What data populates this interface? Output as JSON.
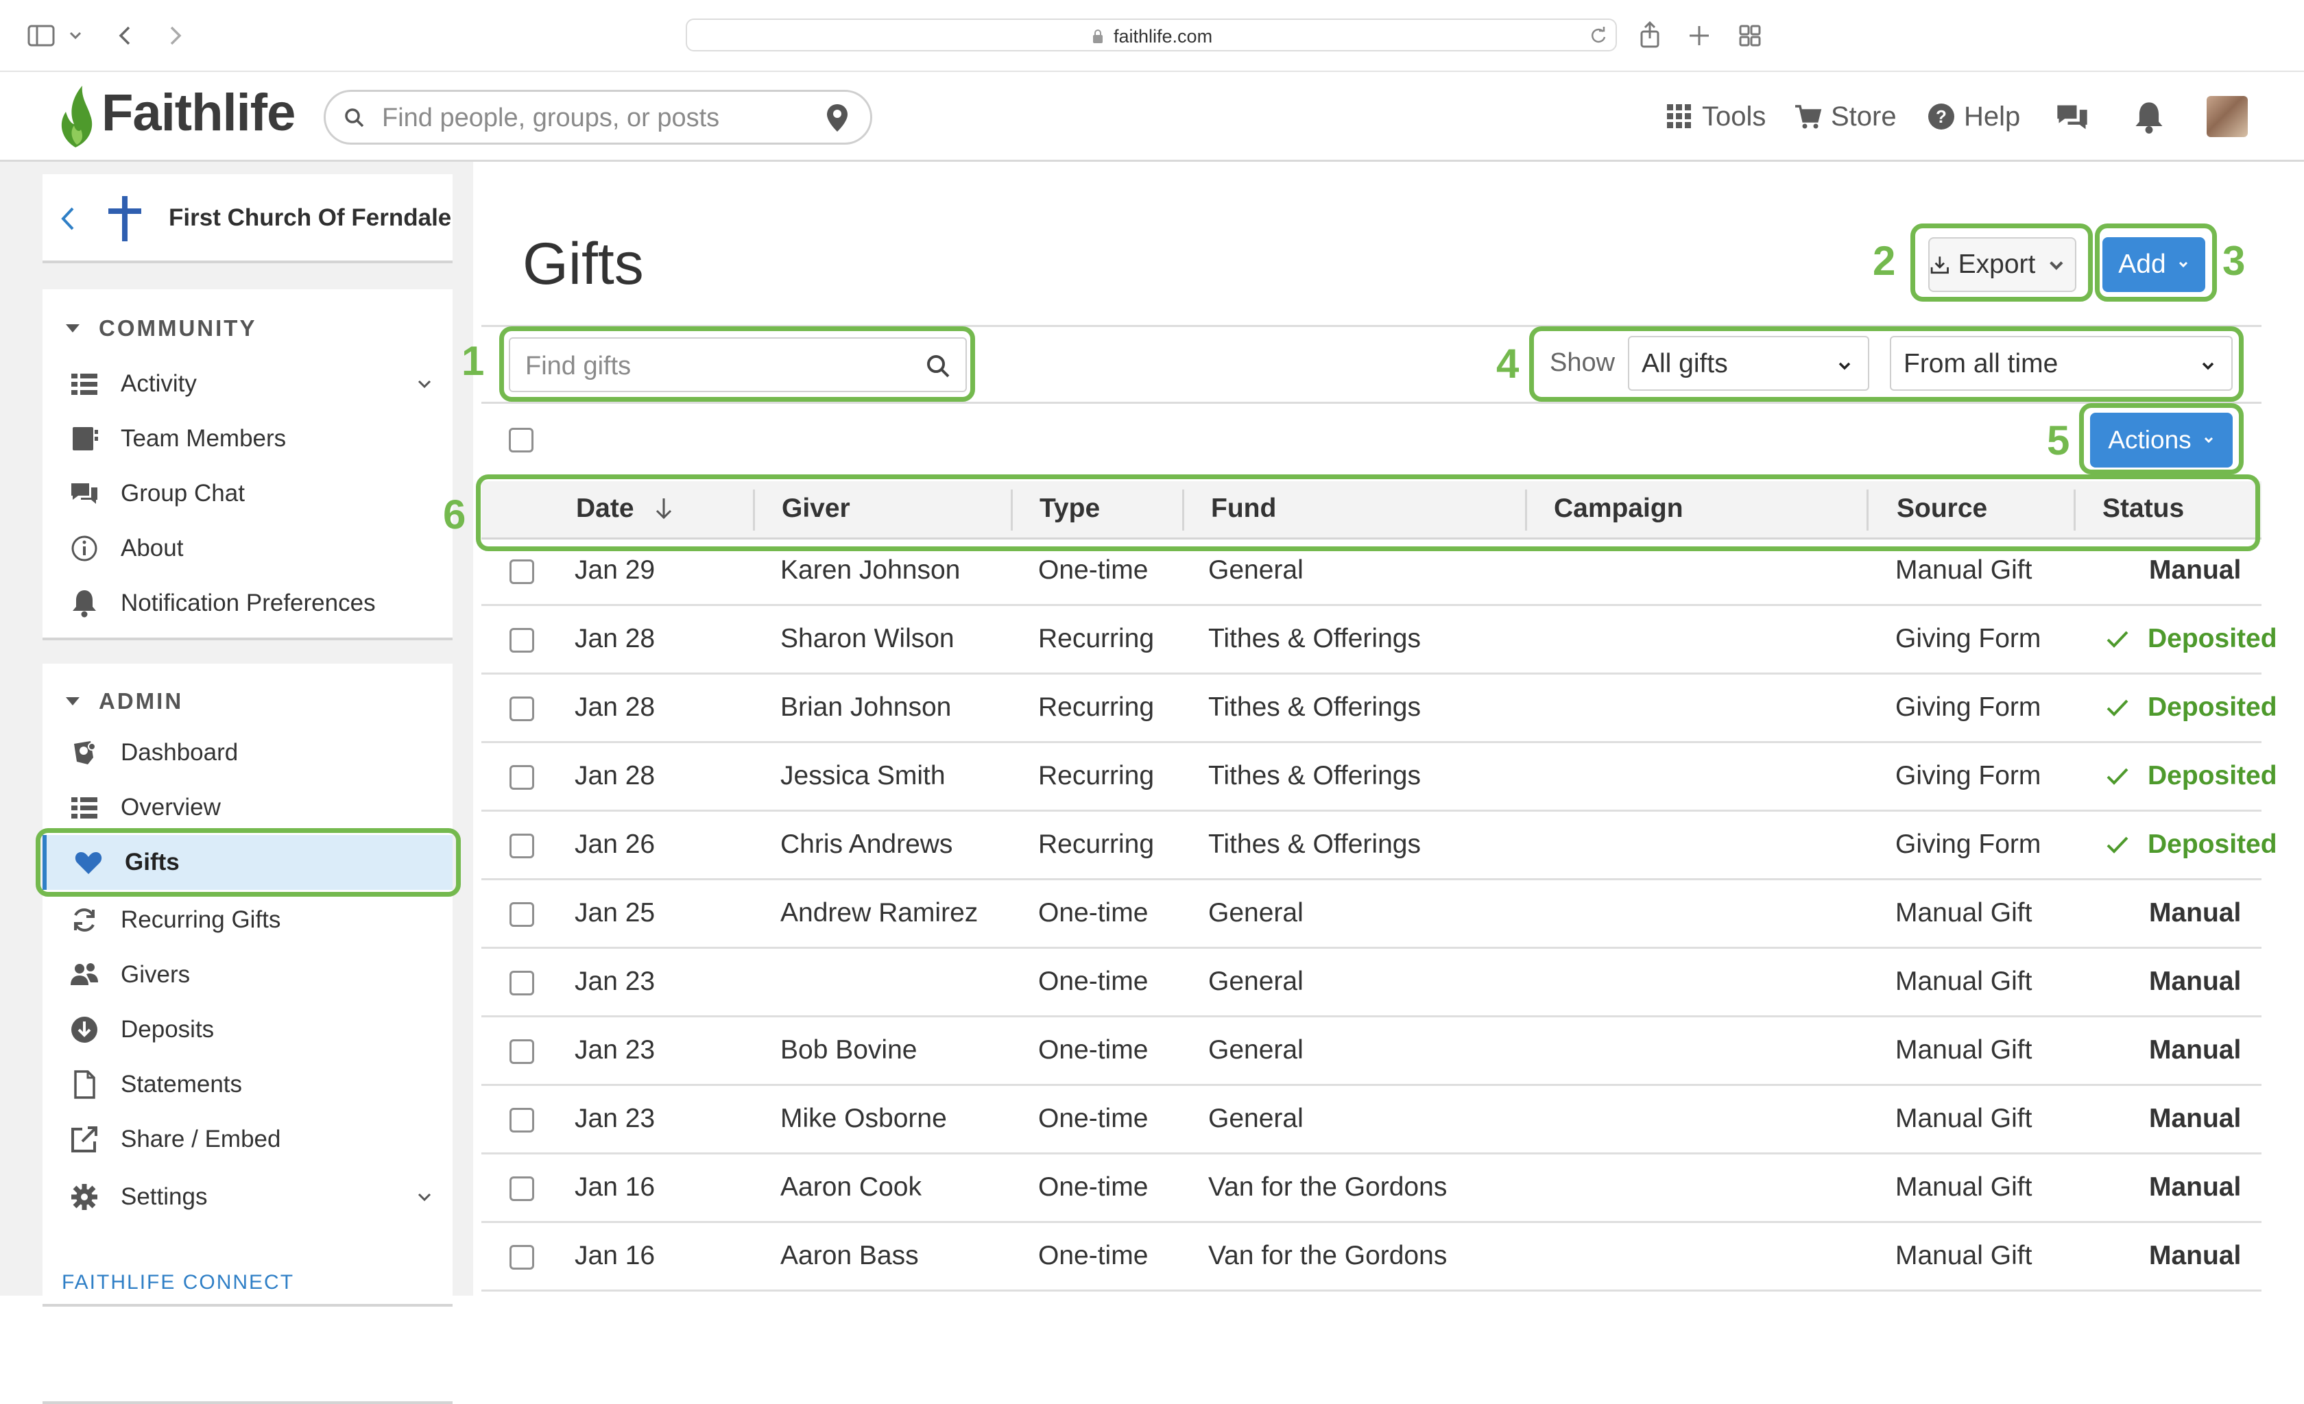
{
  "browser": {
    "url": "faithlife.com"
  },
  "header": {
    "logo_text": "Faithlife",
    "search_placeholder": "Find people, groups, or posts",
    "nav": {
      "tools": "Tools",
      "store": "Store",
      "help": "Help"
    }
  },
  "sidebar": {
    "church_name": "First Church Of Ferndale",
    "community": {
      "heading": "COMMUNITY",
      "items": [
        {
          "label": "Activity",
          "icon": "activity-list-icon"
        },
        {
          "label": "Team Members",
          "icon": "team-members-icon"
        },
        {
          "label": "Group Chat",
          "icon": "chat-icon"
        },
        {
          "label": "About",
          "icon": "info-icon"
        },
        {
          "label": "Notification Preferences",
          "icon": "bell-icon"
        }
      ]
    },
    "admin": {
      "heading": "ADMIN",
      "items": [
        {
          "label": "Dashboard",
          "icon": "dashboard-icon"
        },
        {
          "label": "Overview",
          "icon": "overview-list-icon"
        },
        {
          "label": "Gifts",
          "icon": "heart-icon"
        },
        {
          "label": "Recurring Gifts",
          "icon": "recurring-icon"
        },
        {
          "label": "Givers",
          "icon": "givers-icon"
        },
        {
          "label": "Deposits",
          "icon": "deposits-icon"
        },
        {
          "label": "Statements",
          "icon": "statements-icon"
        },
        {
          "label": "Share / Embed",
          "icon": "share-icon"
        },
        {
          "label": "Settings",
          "icon": "gear-icon"
        }
      ]
    },
    "connect_heading": "FAITHLIFE CONNECT"
  },
  "main": {
    "title": "Gifts",
    "export_label": "Export",
    "add_label": "Add",
    "find_placeholder": "Find gifts",
    "show_label": "Show",
    "filter_gifts": "All gifts",
    "filter_time": "From all time",
    "actions_label": "Actions",
    "columns": [
      "Date",
      "Giver",
      "Type",
      "Fund",
      "Campaign",
      "Source",
      "Status"
    ],
    "rows": [
      {
        "date": "Jan 29",
        "giver": "Karen Johnson",
        "type": "One-time",
        "fund": "General",
        "campaign": "",
        "source": "Manual Gift",
        "status": "Manual",
        "deposited": false
      },
      {
        "date": "Jan 28",
        "giver": "Sharon Wilson",
        "type": "Recurring",
        "fund": "Tithes & Offerings",
        "campaign": "",
        "source": "Giving Form",
        "status": "Deposited",
        "deposited": true
      },
      {
        "date": "Jan 28",
        "giver": "Brian Johnson",
        "type": "Recurring",
        "fund": "Tithes & Offerings",
        "campaign": "",
        "source": "Giving Form",
        "status": "Deposited",
        "deposited": true
      },
      {
        "date": "Jan 28",
        "giver": "Jessica Smith",
        "type": "Recurring",
        "fund": "Tithes & Offerings",
        "campaign": "",
        "source": "Giving Form",
        "status": "Deposited",
        "deposited": true
      },
      {
        "date": "Jan 26",
        "giver": "Chris Andrews",
        "type": "Recurring",
        "fund": "Tithes & Offerings",
        "campaign": "",
        "source": "Giving Form",
        "status": "Deposited",
        "deposited": true
      },
      {
        "date": "Jan 25",
        "giver": "Andrew Ramirez",
        "type": "One-time",
        "fund": "General",
        "campaign": "",
        "source": "Manual Gift",
        "status": "Manual",
        "deposited": false
      },
      {
        "date": "Jan 23",
        "giver": "",
        "type": "One-time",
        "fund": "General",
        "campaign": "",
        "source": "Manual Gift",
        "status": "Manual",
        "deposited": false
      },
      {
        "date": "Jan 23",
        "giver": "Bob Bovine",
        "type": "One-time",
        "fund": "General",
        "campaign": "",
        "source": "Manual Gift",
        "status": "Manual",
        "deposited": false
      },
      {
        "date": "Jan 23",
        "giver": "Mike Osborne",
        "type": "One-time",
        "fund": "General",
        "campaign": "",
        "source": "Manual Gift",
        "status": "Manual",
        "deposited": false
      },
      {
        "date": "Jan 16",
        "giver": "Aaron Cook",
        "type": "One-time",
        "fund": "Van for the Gordons",
        "campaign": "",
        "source": "Manual Gift",
        "status": "Manual",
        "deposited": false
      },
      {
        "date": "Jan 16",
        "giver": "Aaron Bass",
        "type": "One-time",
        "fund": "Van for the Gordons",
        "campaign": "",
        "source": "Manual Gift",
        "status": "Manual",
        "deposited": false
      }
    ]
  },
  "callouts": [
    "1",
    "2",
    "3",
    "4",
    "5",
    "6"
  ],
  "colors": {
    "accent_blue": "#3a8ad8",
    "highlight_green": "#74b94e",
    "deposited_green": "#4e9a2c"
  }
}
